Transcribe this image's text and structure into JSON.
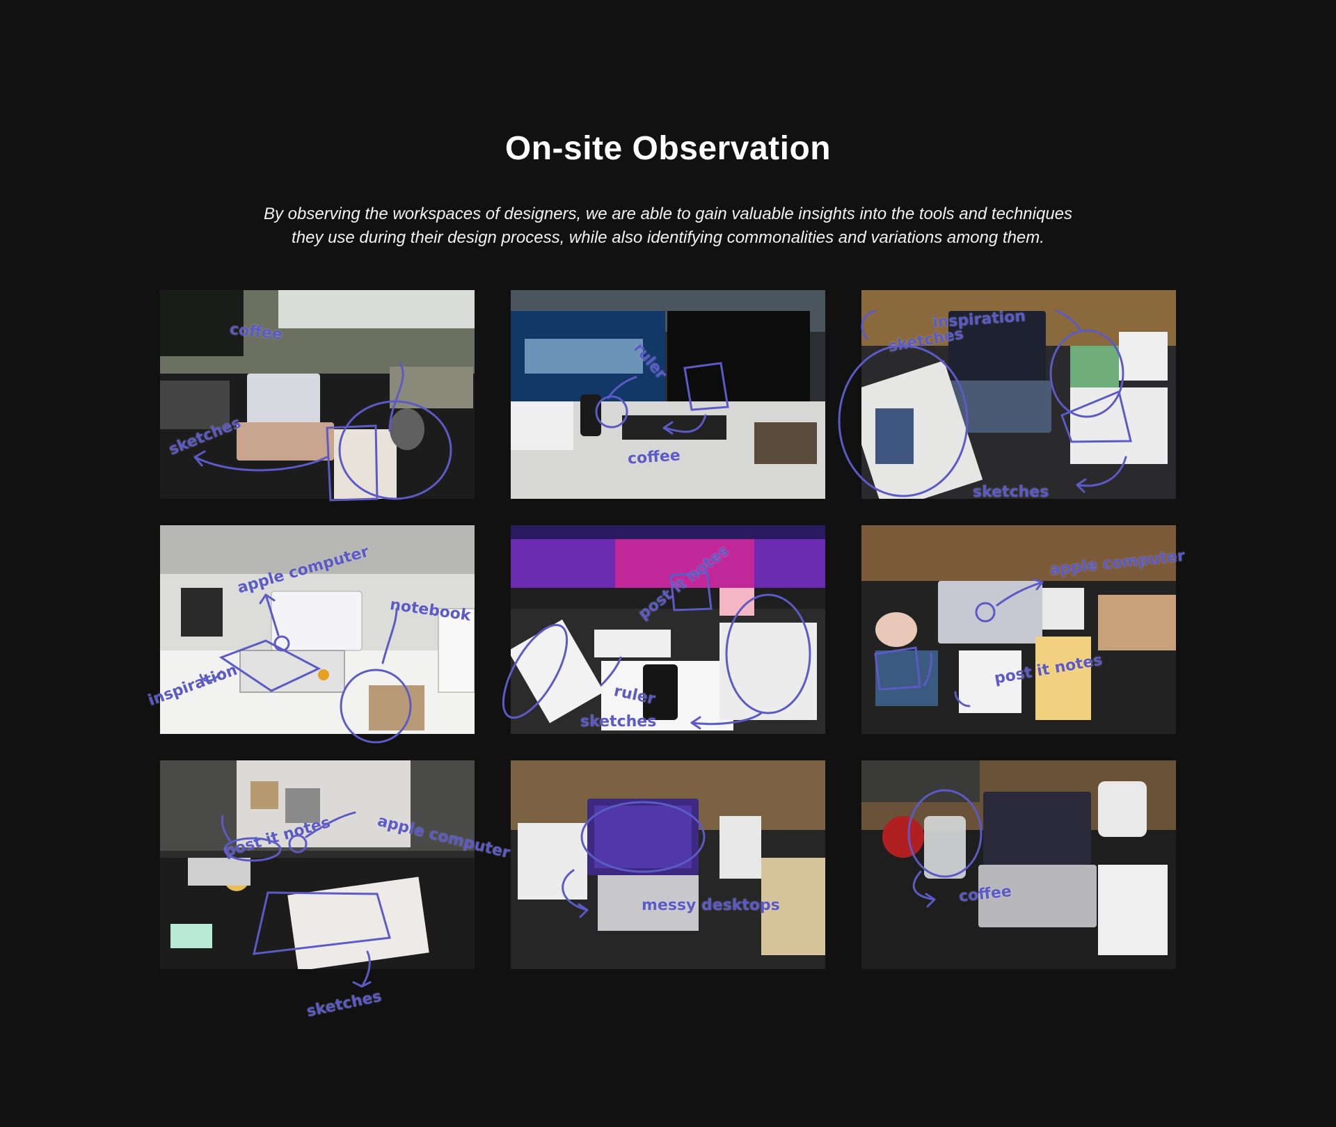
{
  "title": "On-site Observation",
  "subtitle_line1": "By observing the workspaces of designers, we are able to gain valuable insights into the tools and techniques",
  "subtitle_line2": "they use during their design process, while also identifying commonalities and variations among them.",
  "annotation_color": "#5c5ac4",
  "photos": [
    {
      "id": "workspace-1",
      "labels": [
        "coffee",
        "sketches"
      ]
    },
    {
      "id": "workspace-2",
      "labels": [
        "ruler",
        "coffee"
      ]
    },
    {
      "id": "workspace-3",
      "labels": [
        "sketches",
        "inspiration",
        "sketches"
      ]
    },
    {
      "id": "workspace-4",
      "labels": [
        "apple computer",
        "notebook",
        "inspiration"
      ]
    },
    {
      "id": "workspace-5",
      "labels": [
        "post it notes",
        "ruler",
        "sketches"
      ]
    },
    {
      "id": "workspace-6",
      "labels": [
        "apple computer",
        "post it notes"
      ]
    },
    {
      "id": "workspace-7",
      "labels": [
        "post it notes",
        "apple computer",
        "sketches"
      ]
    },
    {
      "id": "workspace-8",
      "labels": [
        "messy desktops"
      ]
    },
    {
      "id": "workspace-9",
      "labels": [
        "coffee"
      ]
    }
  ]
}
